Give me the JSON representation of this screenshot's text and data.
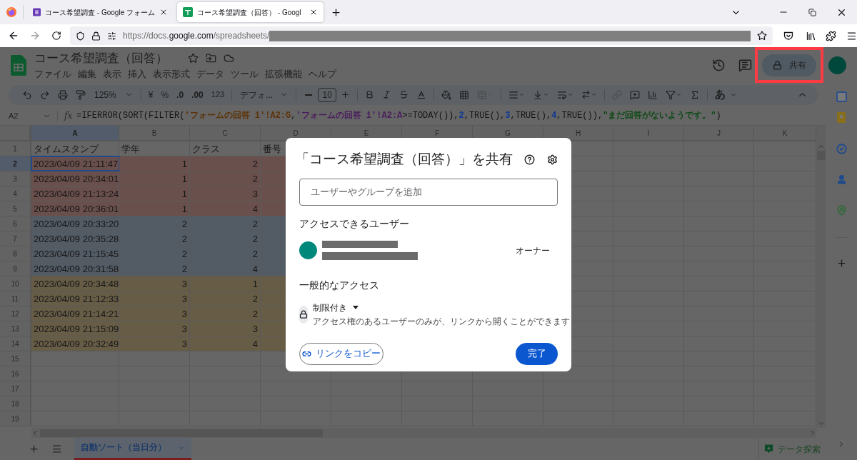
{
  "browser": {
    "tabs": [
      {
        "title": "コース希望調査 - Google フォーム",
        "selected": false,
        "kind": "forms"
      },
      {
        "title": "コース希望調査（回答） - Googl",
        "selected": true,
        "kind": "sheets"
      }
    ],
    "url": {
      "prefix": "https://docs.",
      "domain": "google.com",
      "path": "/spreadsheets/"
    }
  },
  "document": {
    "title": "コース希望調査（回答）",
    "menu": [
      "ファイル",
      "編集",
      "表示",
      "挿入",
      "表示形式",
      "データ",
      "ツール",
      "拡張機能",
      "ヘルプ"
    ],
    "share_button": "共有",
    "share_highlighted": true
  },
  "toolbar": {
    "zoom": "125%",
    "currency": "¥",
    "percent": "%",
    "decrease_decimals": ".0",
    "increase_decimals": ".00",
    "number_format": "123",
    "font": "デフォ...",
    "font_size": "10",
    "input_tools": "あ"
  },
  "formula_bar": {
    "cell_ref": "A2",
    "function_label": "fx",
    "formula": [
      {
        "text": "=IFERROR(SORT(FILTER("
      },
      {
        "text": "'フォームの回答 1'!A2:G",
        "color": "#5e3308"
      },
      {
        "text": ","
      },
      {
        "text": "'フォームの回答 1'!A2:A",
        "color": "#4a1d5e"
      },
      {
        "text": ">=TODAY()),"
      },
      {
        "text": "2",
        "color": "#0c3796"
      },
      {
        "text": ",TRUE(),"
      },
      {
        "text": "3",
        "color": "#0c3796"
      },
      {
        "text": ",TRUE(),"
      },
      {
        "text": "4",
        "color": "#0c3796"
      },
      {
        "text": ",TRUE()),"
      },
      {
        "text": "\"まだ回答がないようです。\"",
        "color": "#0e4a16"
      },
      {
        "text": ")"
      }
    ]
  },
  "grid": {
    "columns": [
      {
        "label": "A",
        "selected": true
      },
      {
        "label": "B",
        "selected": false
      },
      {
        "label": "C",
        "selected": false
      },
      {
        "label": "D",
        "selected": false
      },
      {
        "label": "E",
        "selected": false
      },
      {
        "label": "F",
        "selected": false
      },
      {
        "label": "G",
        "selected": false
      },
      {
        "label": "H",
        "selected": false
      },
      {
        "label": "I",
        "selected": false
      },
      {
        "label": "J",
        "selected": false
      },
      {
        "label": "K",
        "selected": false
      }
    ],
    "rows": [
      {
        "number": "1",
        "selected": false,
        "kind": "header",
        "cells": [
          "タイムスタンプ",
          "学年",
          "クラス",
          "番号"
        ]
      },
      {
        "number": "2",
        "selected": true,
        "kind": "data",
        "color": "#6a504d",
        "cells": [
          "2023/04/09 21:11:47",
          "1",
          "2"
        ]
      },
      {
        "number": "3",
        "selected": false,
        "kind": "data",
        "color": "#6a504d",
        "cells": [
          "2023/04/09 20:34:01",
          "1",
          "2"
        ]
      },
      {
        "number": "4",
        "selected": false,
        "kind": "data",
        "color": "#6a504d",
        "cells": [
          "2023/04/09 21:13:24",
          "1",
          "3"
        ]
      },
      {
        "number": "5",
        "selected": false,
        "kind": "data",
        "color": "#6a504d",
        "cells": [
          "2023/04/09 20:36:01",
          "1",
          "4"
        ]
      },
      {
        "number": "6",
        "selected": false,
        "kind": "data",
        "color": "#535b65",
        "cells": [
          "2023/04/09 20:33:20",
          "2",
          "2"
        ]
      },
      {
        "number": "7",
        "selected": false,
        "kind": "data",
        "color": "#535b65",
        "cells": [
          "2023/04/09 20:35:28",
          "2",
          "2"
        ]
      },
      {
        "number": "8",
        "selected": false,
        "kind": "data",
        "color": "#535b65",
        "cells": [
          "2023/04/09 21:15:45",
          "2",
          "2"
        ]
      },
      {
        "number": "9",
        "selected": false,
        "kind": "data",
        "color": "#535b65",
        "cells": [
          "2023/04/09 20:31:58",
          "2",
          "4"
        ]
      },
      {
        "number": "10",
        "selected": false,
        "kind": "data",
        "color": "#675d47",
        "cells": [
          "2023/04/09 20:34:48",
          "3",
          "1"
        ]
      },
      {
        "number": "11",
        "selected": false,
        "kind": "data",
        "color": "#675d47",
        "cells": [
          "2023/04/09 21:12:33",
          "3",
          "2"
        ]
      },
      {
        "number": "12",
        "selected": false,
        "kind": "data",
        "color": "#675d47",
        "cells": [
          "2023/04/09 21:14:21",
          "3",
          "2"
        ]
      },
      {
        "number": "13",
        "selected": false,
        "kind": "data",
        "color": "#675d47",
        "cells": [
          "2023/04/09 21:15:09",
          "3",
          "3"
        ]
      },
      {
        "number": "14",
        "selected": false,
        "kind": "data",
        "color": "#675d47",
        "cells": [
          "2023/04/09 20:32:49",
          "3",
          "4"
        ]
      },
      {
        "number": "15",
        "selected": false,
        "kind": "data"
      },
      {
        "number": "16",
        "selected": false,
        "kind": "data"
      },
      {
        "number": "17",
        "selected": false,
        "kind": "data"
      },
      {
        "number": "18",
        "selected": false,
        "kind": "data"
      },
      {
        "number": "19",
        "selected": false,
        "kind": "data"
      }
    ]
  },
  "sheet_tabs": [
    {
      "label": "自動ソート（当日分）",
      "selected": true
    }
  ],
  "explore_button": "データ探索",
  "dialog": {
    "title": "「コース希望調査（回答）」を共有",
    "add_placeholder": "ユーザーやグループを追加",
    "people_heading": "アクセスできるユーザー",
    "owner_role": "オーナー",
    "general_heading": "一般的なアクセス",
    "access_level": "制限付き",
    "access_description": "アクセス権のあるユーザーのみが、リンクから開くことができます",
    "copy_link_button": "リンクをコピー",
    "done_button": "完了"
  }
}
